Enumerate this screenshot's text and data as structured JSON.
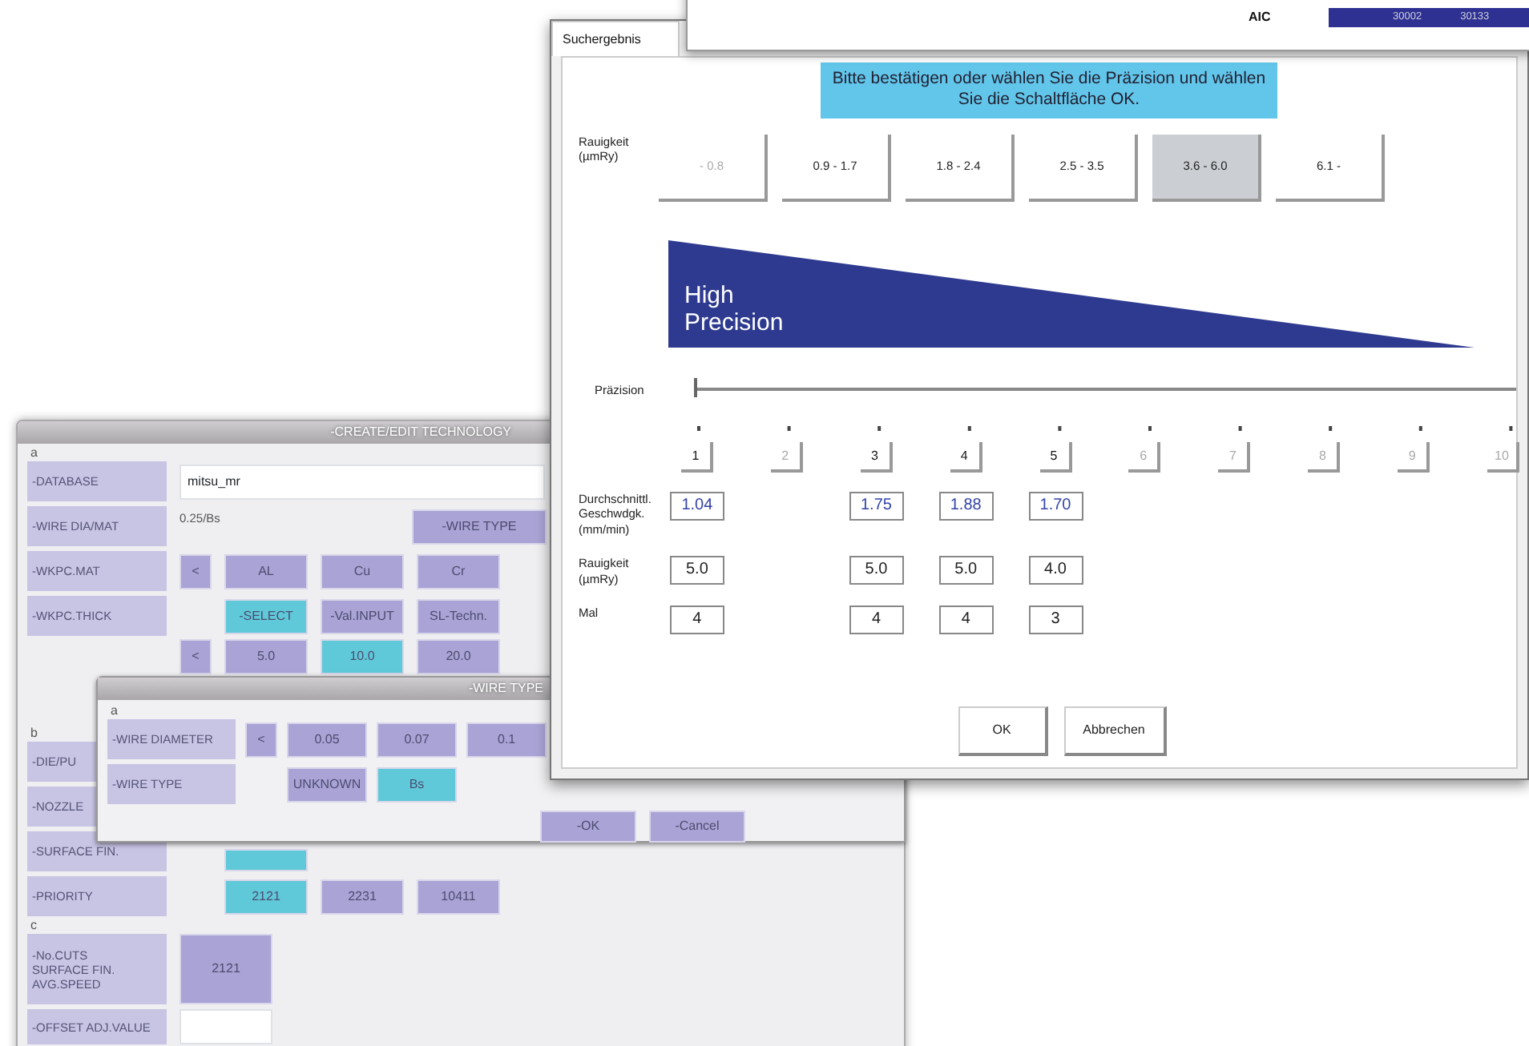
{
  "back_window": {
    "title": "-CREATE/EDIT TECHNOLOGY",
    "sections": [
      {
        "label": "a",
        "rows": [
          {
            "kind": "field",
            "label": "-DATABASE",
            "value": "mitsu_mr"
          },
          {
            "kind": "text_button",
            "label": "-WIRE DIA/MAT",
            "text": "0.25/Bs",
            "button": "-WIRE TYPE"
          },
          {
            "kind": "buttons",
            "label": "-WKPC.MAT",
            "indent": false,
            "buttons": [
              {
                "label": "<",
                "selected": false
              },
              {
                "label": "AL",
                "selected": false
              },
              {
                "label": "Cu",
                "selected": false
              },
              {
                "label": "Cr",
                "selected": false
              }
            ]
          },
          {
            "kind": "buttons",
            "label": "-WKPC.THICK",
            "indent": true,
            "buttons": [
              {
                "label": "-SELECT",
                "selected": true
              },
              {
                "label": "-Val.INPUT",
                "selected": false
              },
              {
                "label": "SL-Techn.",
                "selected": false
              }
            ]
          },
          {
            "kind": "buttons",
            "indent": false,
            "buttons": [
              {
                "label": "<",
                "selected": false
              },
              {
                "label": "5.0",
                "selected": false
              },
              {
                "label": "10.0",
                "selected": true
              },
              {
                "label": "20.0",
                "selected": false
              }
            ]
          }
        ]
      },
      {
        "label": "b",
        "rows": [
          {
            "kind": "label",
            "label": "-DIE/PU"
          },
          {
            "kind": "label",
            "label": "-NOZZLE"
          },
          {
            "kind": "buttons",
            "label": "-SURFACE FIN.",
            "indent": true,
            "buttons": [
              {
                "selected": true
              }
            ]
          },
          {
            "kind": "buttons",
            "label": "-PRIORITY",
            "indent": true,
            "buttons": [
              {
                "label": "2121",
                "selected": true
              },
              {
                "label": "2231",
                "selected": false
              },
              {
                "label": "10411",
                "selected": false
              }
            ]
          }
        ]
      },
      {
        "label": "c",
        "rows": [
          {
            "kind": "tall_buttons",
            "label": "-No.CUTS\nSURFACE FIN.\nAVG.SPEED",
            "buttons": [
              {
                "label": "2121",
                "selected": false
              }
            ]
          },
          {
            "kind": "field",
            "label": "-OFFSET ADJ.VALUE"
          }
        ]
      }
    ]
  },
  "dialog": {
    "title": "-WIRE TYPE",
    "section": "a",
    "rows": [
      {
        "label": "-WIRE DIAMETER",
        "indent": false,
        "buttons": [
          {
            "label": "<",
            "selected": false
          },
          {
            "label": "0.05",
            "selected": false
          },
          {
            "label": "0.07",
            "selected": false
          },
          {
            "label": "0.1",
            "selected": false
          }
        ]
      },
      {
        "label": "-WIRE TYPE",
        "indent": true,
        "buttons": [
          {
            "label": "UNKNOWN",
            "selected": false
          },
          {
            "label": "Bs",
            "selected": true
          }
        ]
      }
    ],
    "actions": [
      "-OK",
      "-Cancel"
    ]
  },
  "result_window": {
    "tabs": [
      {
        "label": "Suchergebnis",
        "selected": true
      }
    ],
    "message": "Bitte bestätigen oder wählen Sie die Präzision und wählen Sie die Schaltfläche OK.",
    "roughness_label": "Rauigkeit\n(µmRy)",
    "roughness_options": [
      {
        "label": "- 0.8",
        "disabled": true,
        "selected": false
      },
      {
        "label": "0.9 - 1.7",
        "disabled": false,
        "selected": false
      },
      {
        "label": "1.8 - 2.4",
        "disabled": false,
        "selected": false
      },
      {
        "label": "2.5 - 3.5",
        "disabled": false,
        "selected": false
      },
      {
        "label": "3.6 - 6.0",
        "disabled": false,
        "selected": true
      },
      {
        "label": "6.1 -",
        "disabled": false,
        "selected": false
      }
    ],
    "banner": "High\nPrecision",
    "precision_label": "Präzision",
    "precision_slider": {
      "level": 0
    },
    "row_labels": {
      "speed": "Durchschnittl.\nGeschwdgk.\n(mm/min)",
      "roughness": "Rauigkeit\n(µmRy)",
      "times": "Mal"
    },
    "levels": [
      {
        "label": "1",
        "enabled": true,
        "speed": "1.04",
        "roughness": "5.0",
        "times": "4"
      },
      {
        "label": "2",
        "enabled": false
      },
      {
        "label": "3",
        "enabled": true,
        "speed": "1.75",
        "roughness": "5.0",
        "times": "4"
      },
      {
        "label": "4",
        "enabled": true,
        "speed": "1.88",
        "roughness": "5.0",
        "times": "4"
      },
      {
        "label": "5",
        "enabled": true,
        "speed": "1.70",
        "roughness": "4.0",
        "times": "3"
      },
      {
        "label": "6",
        "enabled": false
      },
      {
        "label": "7",
        "enabled": false
      },
      {
        "label": "8",
        "enabled": false
      },
      {
        "label": "9",
        "enabled": false
      },
      {
        "label": "10",
        "enabled": false
      }
    ],
    "buttons": [
      "OK",
      "Abbrechen"
    ]
  },
  "top_window": {
    "row_label": "AIC",
    "values": [
      "30002",
      "30133"
    ]
  }
}
